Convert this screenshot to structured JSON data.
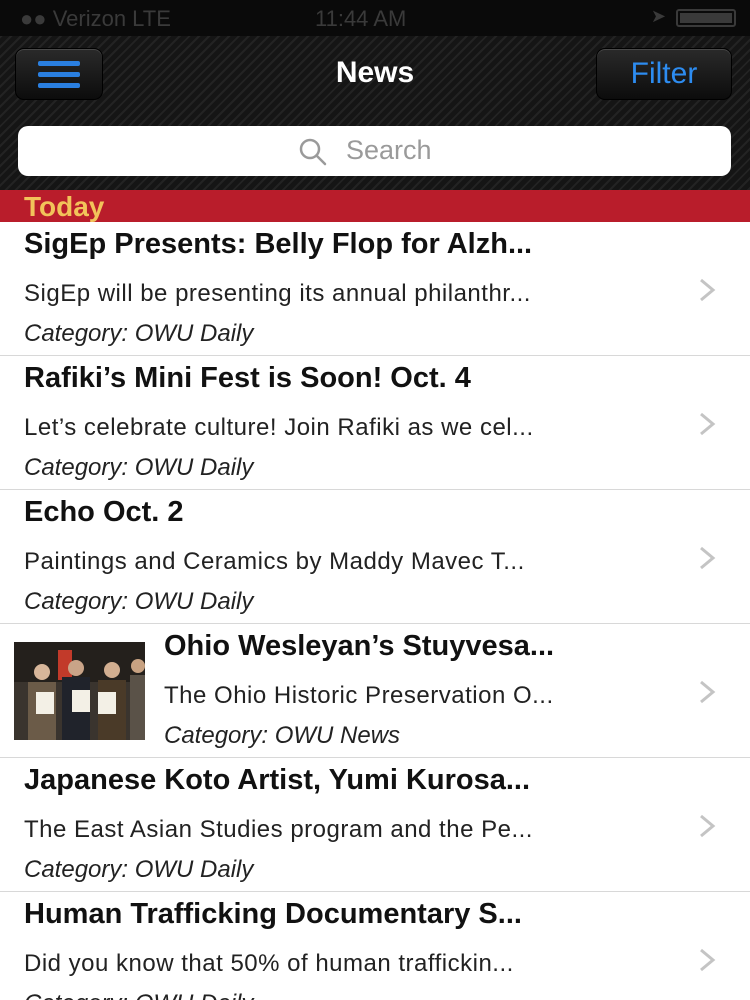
{
  "status_bar": {
    "carrier": "●● Verizon  LTE",
    "time": "11:44 AM"
  },
  "nav": {
    "title": "News",
    "filter_label": "Filter",
    "menu_icon": "hamburger-menu-icon"
  },
  "search": {
    "placeholder": "Search",
    "icon": "search-icon"
  },
  "section": {
    "label": "Today"
  },
  "colors": {
    "accent_blue": "#2d8cf0",
    "section_red": "#b91d2b",
    "section_text": "#f2c35a"
  },
  "items": [
    {
      "title": "SigEp Presents: Belly Flop for Alzh...",
      "summary": "SigEp will be presenting its annual philanthr...",
      "category": "Category: OWU Daily"
    },
    {
      "title": "Rafiki’s Mini Fest is Soon! Oct. 4",
      "summary": "Let’s celebrate culture! Join Rafiki as we cel...",
      "category": "Category: OWU Daily"
    },
    {
      "title": "Echo Oct. 2",
      "summary": "Paintings and Ceramics by Maddy Mavec T...",
      "category": "Category: OWU Daily"
    },
    {
      "title": "Ohio Wesleyan’s Stuyvesa...",
      "summary": "The Ohio Historic Preservation O...",
      "category": "Category: OWU News",
      "thumbnail": "award-ceremony-photo"
    },
    {
      "title": "Japanese Koto Artist, Yumi Kurosa...",
      "summary": "The East Asian Studies program and the Pe...",
      "category": "Category: OWU Daily"
    },
    {
      "title": "Human Trafficking Documentary S...",
      "summary": "Did you know that 50% of human traffickin...",
      "category": "Category: OWU Daily"
    }
  ]
}
